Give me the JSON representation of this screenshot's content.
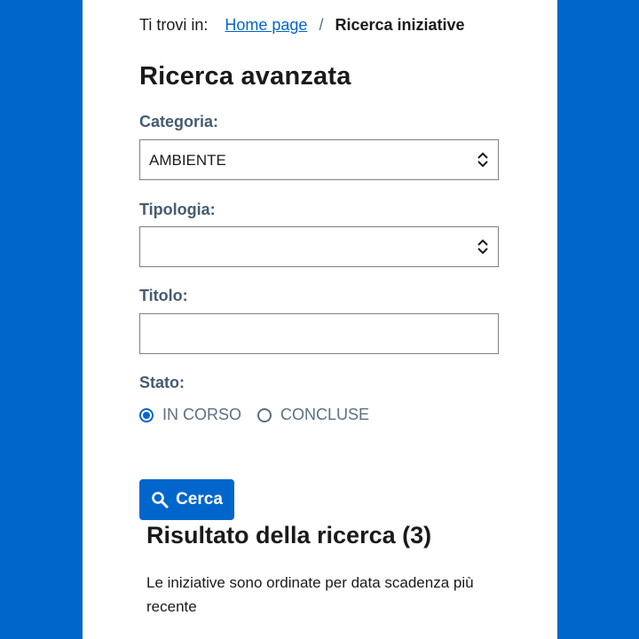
{
  "colors": {
    "brand": "#0066cc",
    "label": "#455b71",
    "text": "#1a1a1a"
  },
  "breadcrumb": {
    "prefix": "Ti trovi in:",
    "home": "Home page",
    "separator": "/",
    "current": "Ricerca iniziative"
  },
  "page": {
    "title": "Ricerca avanzata"
  },
  "form": {
    "categoria": {
      "label": "Categoria:",
      "value": "AMBIENTE",
      "icon": "chevron-up-down-icon"
    },
    "tipologia": {
      "label": "Tipologia:",
      "value": "",
      "icon": "chevron-up-down-icon"
    },
    "titolo": {
      "label": "Titolo:",
      "value": "",
      "placeholder": ""
    },
    "stato": {
      "label": "Stato:",
      "options": [
        {
          "label": "IN CORSO",
          "checked": true
        },
        {
          "label": "CONCLUSE",
          "checked": false
        }
      ]
    },
    "search_button": {
      "label": "Cerca",
      "icon": "search-icon"
    }
  },
  "results": {
    "title": "Risultato della ricerca (3)",
    "note": "Le iniziative sono ordinate per data scadenza più recente"
  }
}
